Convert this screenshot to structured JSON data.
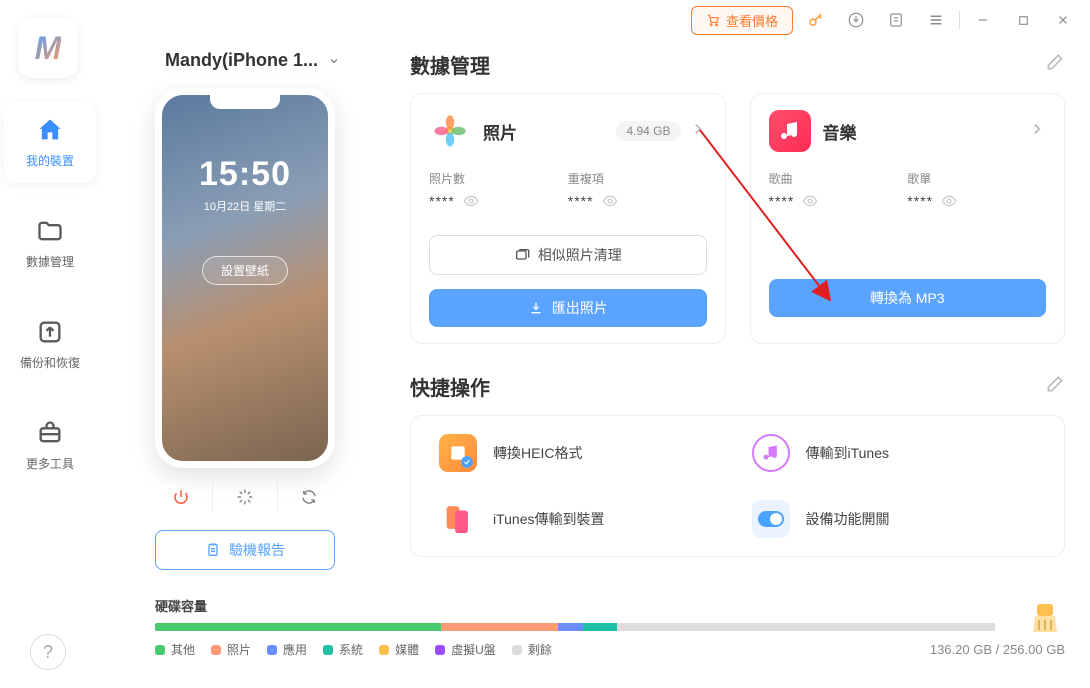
{
  "titlebar": {
    "price": "查看價格"
  },
  "sidebar": {
    "items": [
      {
        "label": "我的裝置"
      },
      {
        "label": "數據管理"
      },
      {
        "label": "備份和恢復"
      },
      {
        "label": "更多工具"
      }
    ]
  },
  "device": {
    "name": "Mandy(iPhone 1..."
  },
  "phone": {
    "time": "15:50",
    "date": "10月22日 星期二",
    "wallpaper_btn": "設置壁紙"
  },
  "verify_btn": "驗機報告",
  "sections": {
    "data_mgmt": "數據管理",
    "quick": "快捷操作"
  },
  "cards": {
    "photos": {
      "name": "照片",
      "size": "4.94 GB",
      "stat1_label": "照片數",
      "stat2_label": "重複項",
      "stars": "****",
      "btn_similar": "相似照片清理",
      "btn_export": "匯出照片"
    },
    "music": {
      "name": "音樂",
      "stat1_label": "歌曲",
      "stat2_label": "歌單",
      "stars": "****",
      "btn_mp3": "轉換為 MP3"
    }
  },
  "quick_actions": {
    "heic": "轉換HEIC格式",
    "to_itunes": "傳輸到iTunes",
    "itunes_device": "iTunes傳輸到裝置",
    "device_switch": "設備功能開關"
  },
  "storage": {
    "title": "硬碟容量",
    "legend": {
      "other": "其他",
      "photo": "照片",
      "app": "應用",
      "system": "系統",
      "media": "媒體",
      "vdisk": "虛擬U盤",
      "remain": "剩餘"
    },
    "text": "136.20 GB / 256.00 GB",
    "colors": {
      "other": "#4ac96e",
      "photo": "#ff9a76",
      "app": "#6a8dff",
      "system": "#1fbfa8",
      "media": "#ffc04d",
      "vdisk": "#9b4dff",
      "remain": "#dcdcdc"
    }
  }
}
